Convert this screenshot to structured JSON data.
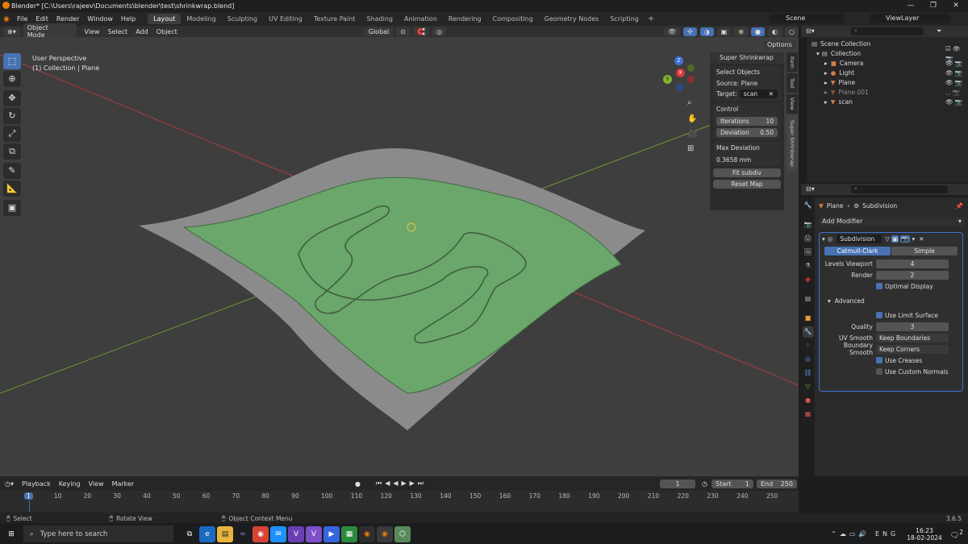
{
  "window": {
    "title": "Blender* [C:\\Users\\rajeev\\Documents\\blender\\test\\shrinkwrap.blend]"
  },
  "menus": [
    "File",
    "Edit",
    "Render",
    "Window",
    "Help"
  ],
  "workspaces": [
    "Layout",
    "Modeling",
    "Sculpting",
    "UV Editing",
    "Texture Paint",
    "Shading",
    "Animation",
    "Rendering",
    "Compositing",
    "Geometry Nodes",
    "Scripting"
  ],
  "active_workspace": "Layout",
  "scene": {
    "name": "Scene",
    "view_layer": "ViewLayer"
  },
  "viewport_header": {
    "mode": "Object Mode",
    "menus": [
      "View",
      "Select",
      "Add",
      "Object"
    ],
    "orientation": "Global",
    "options": "Options"
  },
  "viewport": {
    "perspective": "User Perspective",
    "context": "(1) Collection | Plane"
  },
  "gizmo": {
    "x": "X",
    "y": "Y",
    "z": "Z"
  },
  "super_shrinkwrap": {
    "title": "Super Shrinkwrap",
    "select_objects": "Select Objects",
    "source": "Source: Plane",
    "target_label": "Target:",
    "target_value": "scan",
    "control": "Control",
    "iterations_label": "Iterations",
    "iterations_value": "10",
    "deviation_label": "Deviation",
    "deviation_value": "0.50",
    "max_dev_label": "Max Deviation",
    "max_dev_value": "0.3658 mm",
    "fit_button": "Fit subdiv",
    "reset_button": "Reset Map"
  },
  "side_tabs": [
    "Item",
    "Tool",
    "View",
    "Super Shrinkwrap"
  ],
  "outliner": {
    "root": "Scene Collection",
    "collection": "Collection",
    "items": [
      {
        "name": "Camera",
        "color": "#d97b46"
      },
      {
        "name": "Light",
        "color": "#d97b46"
      },
      {
        "name": "Plane",
        "color": "#d97b46"
      },
      {
        "name": "Plane.001",
        "color": "#d97b46"
      },
      {
        "name": "scan",
        "color": "#d97b46"
      }
    ]
  },
  "properties": {
    "breadcrumb_object": "Plane",
    "breadcrumb_modifier": "Subdivision",
    "add_modifier": "Add Modifier",
    "modifier_name": "Subdivision",
    "catmull": "Catmull-Clark",
    "simple": "Simple",
    "levels_viewport_label": "Levels Viewport",
    "levels_viewport": "4",
    "render_label": "Render",
    "render": "2",
    "optimal_display": "Optimal Display",
    "advanced": "Advanced",
    "use_limit_surface": "Use Limit Surface",
    "quality_label": "Quality",
    "quality": "3",
    "uv_smooth_label": "UV Smooth",
    "uv_smooth": "Keep Boundaries",
    "boundary_smooth_label": "Boundary Smooth",
    "boundary_smooth": "Keep Corners",
    "use_creases": "Use Creases",
    "use_custom_normals": "Use Custom Normals"
  },
  "timeline": {
    "menus": [
      "Playback",
      "Keying",
      "View",
      "Marker"
    ],
    "current_frame": "1",
    "start_label": "Start",
    "start": "1",
    "end_label": "End",
    "end": "250",
    "ticks": [
      "1",
      "10",
      "20",
      "30",
      "40",
      "50",
      "60",
      "70",
      "80",
      "90",
      "100",
      "110",
      "120",
      "130",
      "140",
      "150",
      "160",
      "170",
      "180",
      "190",
      "200",
      "210",
      "220",
      "230",
      "240",
      "250"
    ]
  },
  "statusbar": {
    "select": "Select",
    "rotate": "Rotate View",
    "context": "Object Context Menu",
    "version": "3.6.5"
  },
  "taskbar": {
    "search": "Type here to search",
    "time": "16:23",
    "date": "18-02-2024",
    "notif": "2"
  }
}
